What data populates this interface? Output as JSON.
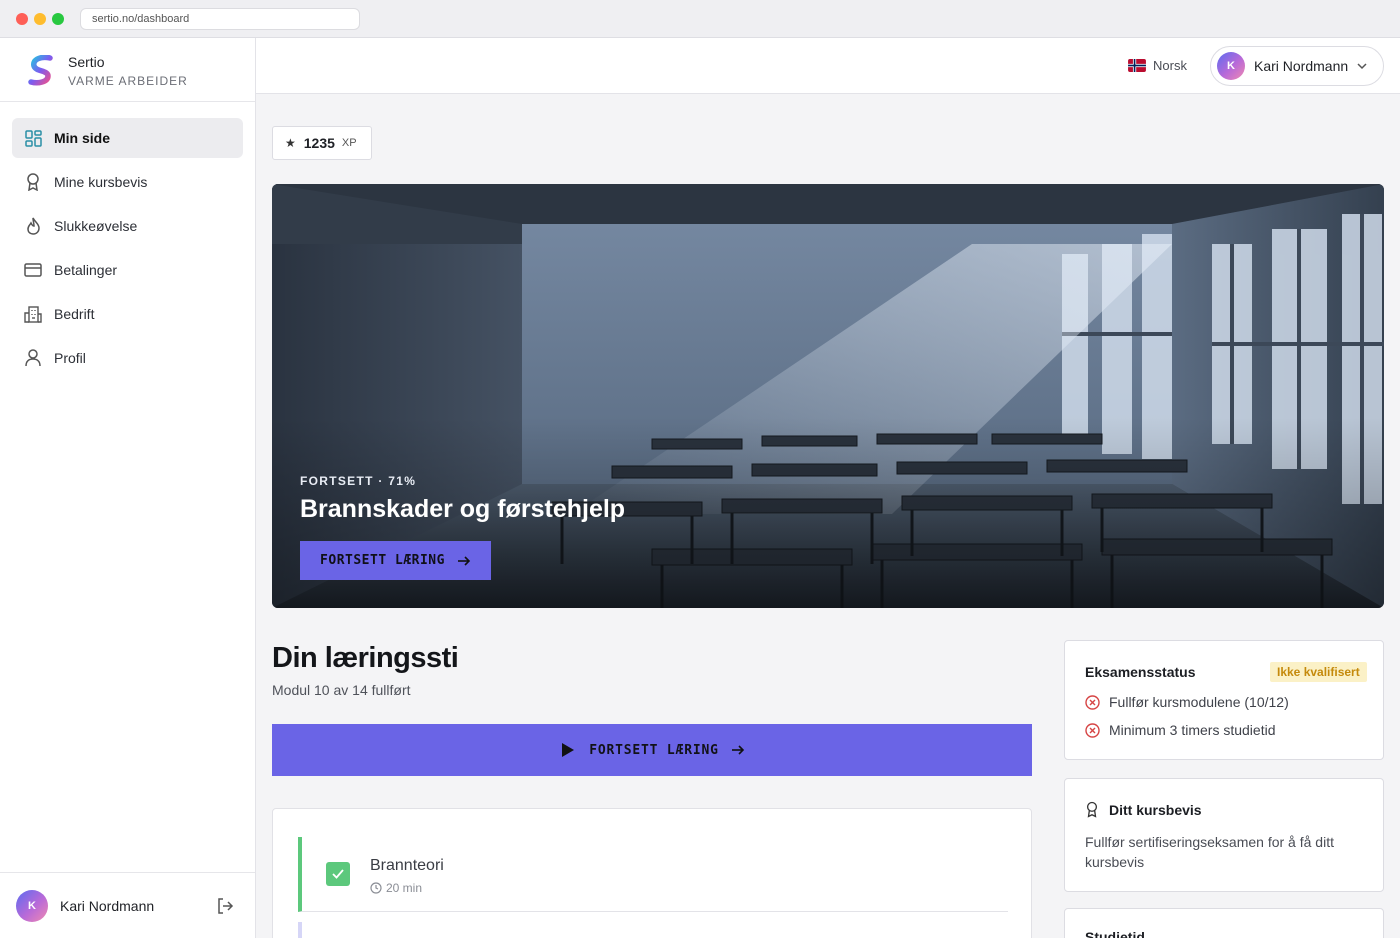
{
  "browser": {
    "url": "sertio.no/dashboard"
  },
  "brand": {
    "name": "Sertio",
    "subtitle": "VARME ARBEIDER"
  },
  "sidebar": {
    "items": [
      {
        "label": "Min side",
        "icon": "dashboard-grid-icon",
        "active": true
      },
      {
        "label": "Mine kursbevis",
        "icon": "award-ribbon-icon",
        "active": false
      },
      {
        "label": "Slukkeøvelse",
        "icon": "flame-icon",
        "active": false
      },
      {
        "label": "Betalinger",
        "icon": "credit-card-icon",
        "active": false
      },
      {
        "label": "Bedrift",
        "icon": "building-icon",
        "active": false
      },
      {
        "label": "Profil",
        "icon": "user-icon",
        "active": false
      }
    ],
    "user": {
      "initial": "K",
      "name": "Kari Nordmann",
      "logout_icon": "logout-icon"
    }
  },
  "topbar": {
    "language": "Norsk",
    "user": {
      "initial": "K",
      "name": "Kari Nordmann"
    }
  },
  "xp": {
    "value": "1235",
    "unit": "XP",
    "icon": "star-icon"
  },
  "hero": {
    "kicker": "FORTSETT · 71%",
    "progress_percent": 71,
    "title": "Brannskader og førstehjelp",
    "button": "FORTSETT LÆRING"
  },
  "path": {
    "title": "Din læringssti",
    "subtitle": "Modul 10 av 14 fullført",
    "button": "FORTSETT LÆRING",
    "modules": [
      {
        "title": "Brannteori",
        "duration": "20 min",
        "completed": true
      }
    ]
  },
  "exam": {
    "title": "Eksamensstatus",
    "badge": "Ikke kvalifisert",
    "requirements": [
      {
        "text": "Fullfør kursmodulene (10/12)",
        "met": false
      },
      {
        "text": "Minimum 3 timers studietid",
        "met": false
      }
    ]
  },
  "certificate": {
    "title": "Ditt kursbevis",
    "body": "Fullfør sertifiseringseksamen for å få ditt kursbevis"
  },
  "study": {
    "title": "Studietid"
  },
  "colors": {
    "accent": "#6a64e6",
    "success": "#5cc87c",
    "warning_bg": "#fbf1c7",
    "warning_text": "#c58a0c",
    "error": "#d64545"
  }
}
